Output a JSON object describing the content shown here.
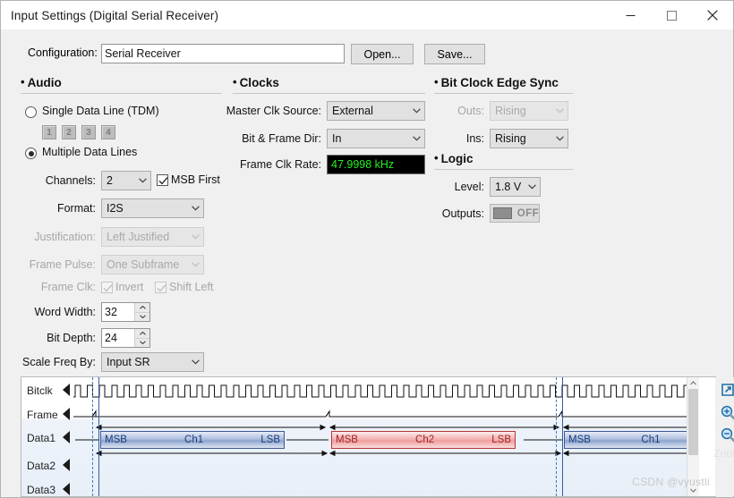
{
  "window": {
    "title": "Input Settings (Digital Serial Receiver)",
    "minimize_label": "minimize",
    "maximize_label": "maximize",
    "close_label": "close"
  },
  "configuration": {
    "label": "Configuration:",
    "value": "Serial Receiver",
    "placeholder": "",
    "open_button": "Open...",
    "save_button": "Save..."
  },
  "audio": {
    "title": "Audio",
    "single_data_line": {
      "label": "Single Data Line (TDM)",
      "selected": false
    },
    "tdm_buttons": [
      "1",
      "2",
      "3",
      "4"
    ],
    "multiple_data_lines": {
      "label": "Multiple Data Lines",
      "selected": true
    },
    "channels": {
      "label": "Channels:",
      "value": "2"
    },
    "msb_first": {
      "label": "MSB First",
      "checked": true
    },
    "format": {
      "label": "Format:",
      "value": "I2S",
      "enabled": true
    },
    "justification": {
      "label": "Justification:",
      "value": "Left Justified",
      "enabled": false
    },
    "frame_pulse": {
      "label": "Frame Pulse:",
      "value": "One Subframe",
      "enabled": false
    },
    "frame_clk": {
      "label": "Frame Clk:",
      "invert": {
        "label": "Invert",
        "checked": true,
        "enabled": false
      },
      "shift_left": {
        "label": "Shift Left",
        "checked": true,
        "enabled": false
      }
    },
    "word_width": {
      "label": "Word Width:",
      "value": "32"
    },
    "bit_depth": {
      "label": "Bit Depth:",
      "value": "24"
    },
    "scale_freq_by": {
      "label": "Scale Freq By:",
      "value": "Input SR"
    }
  },
  "clocks": {
    "title": "Clocks",
    "master_clk_source": {
      "label": "Master Clk Source:",
      "value": "External"
    },
    "bit_frame_dir": {
      "label": "Bit & Frame Dir:",
      "value": "In"
    },
    "frame_clk_rate": {
      "label": "Frame Clk Rate:",
      "value": "47.9998 kHz",
      "text_color": "#22f022",
      "background": "#000000"
    }
  },
  "bit_clock_edge_sync": {
    "title": "Bit Clock Edge Sync",
    "outs": {
      "label": "Outs:",
      "value": "Rising",
      "enabled": false
    },
    "ins": {
      "label": "Ins:",
      "value": "Rising",
      "enabled": true
    }
  },
  "logic": {
    "title": "Logic",
    "level": {
      "label": "Level:",
      "value": "1.8 V"
    },
    "outputs": {
      "label": "Outputs:",
      "state": "OFF"
    }
  },
  "waveform": {
    "rows": [
      "Bitclk",
      "Frame",
      "Data1",
      "Data2",
      "Data3"
    ],
    "blocks": [
      {
        "channel": "Ch1",
        "msb": "MSB",
        "lsb": "LSB",
        "color": "blue"
      },
      {
        "channel": "Ch2",
        "msb": "MSB",
        "lsb": "LSB",
        "color": "red"
      },
      {
        "channel": "Ch1",
        "msb": "MSB",
        "lsb": "",
        "color": "blue"
      }
    ],
    "tools": {
      "popout": "popout-icon",
      "zoom_in": "zoom-in-icon",
      "zoom_out": "zoom-out-icon",
      "tooltip": "Zoom"
    }
  },
  "watermark": "CSDN @vyustli"
}
